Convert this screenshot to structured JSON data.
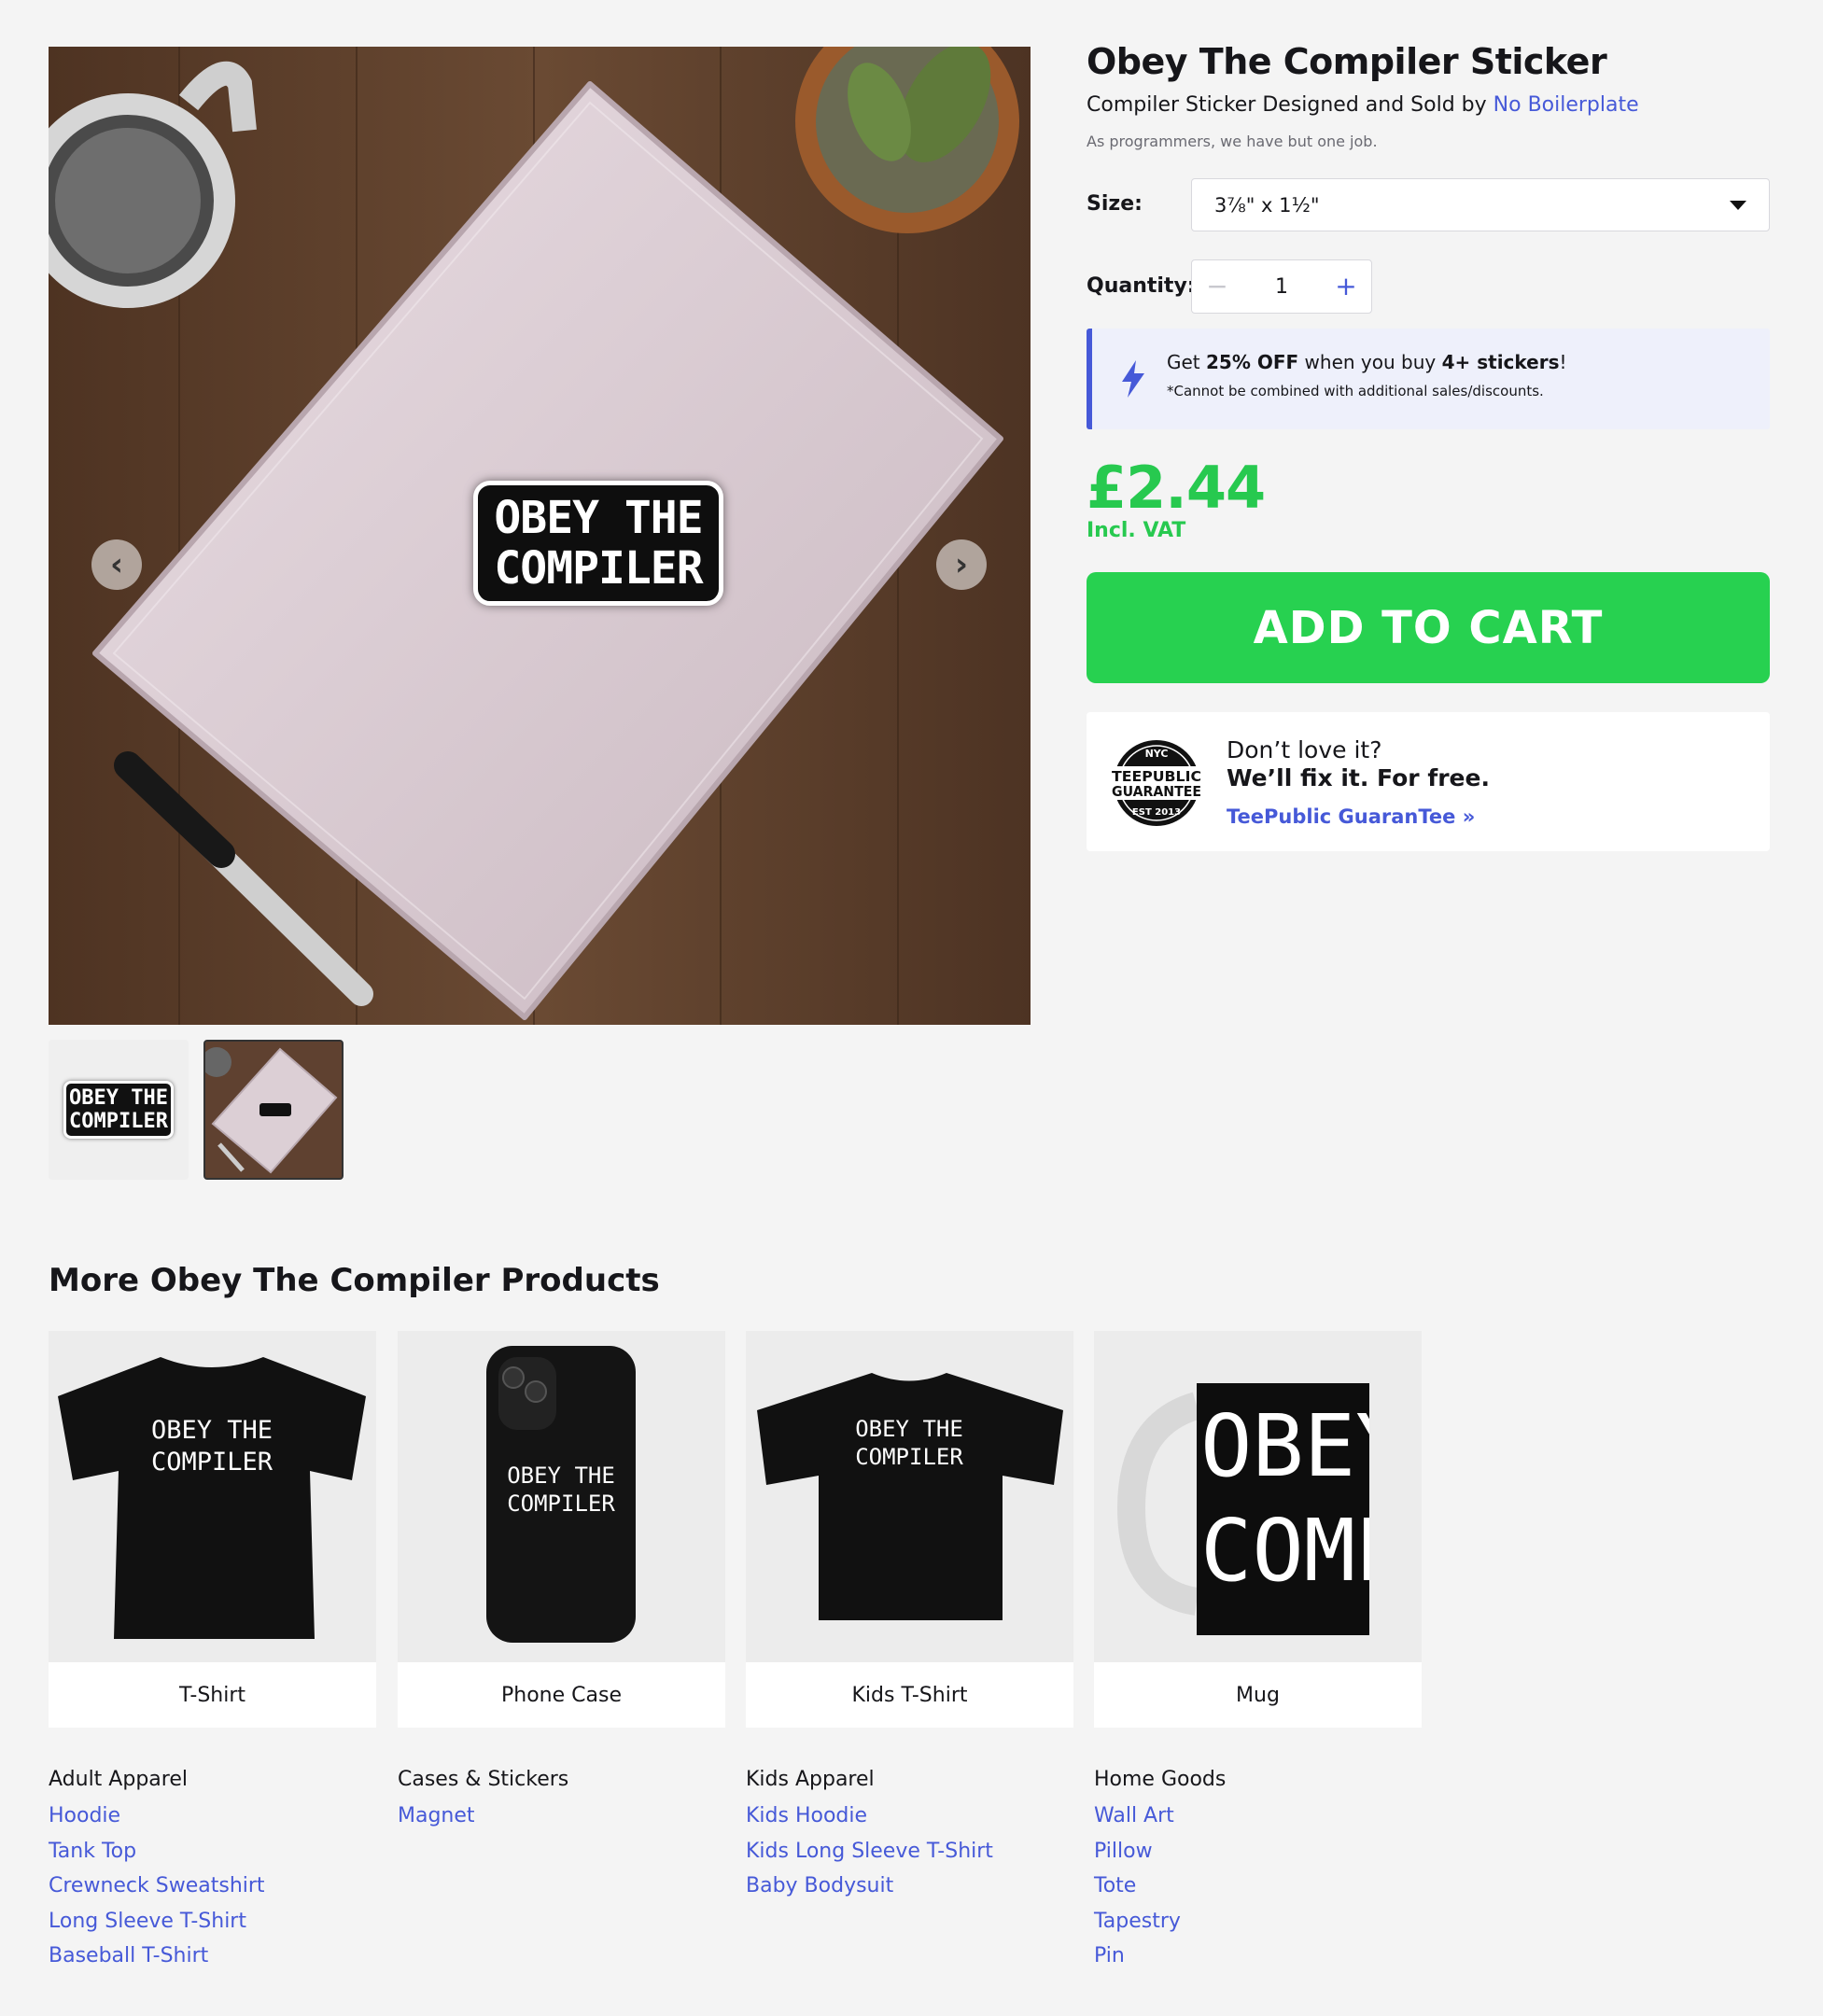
{
  "product": {
    "title": "Obey The Compiler Sticker",
    "subtitle_prefix": "Compiler Sticker Designed and Sold by",
    "seller": "No Boilerplate",
    "description": "As programmers, we have but one job.",
    "sticker_text": [
      "OBEY THE",
      "COMPILER"
    ]
  },
  "options": {
    "size_label": "Size:",
    "size_value": "3⅞\" x 1½\"",
    "quantity_label": "Quantity:",
    "quantity_value": "1",
    "minus": "−",
    "plus": "+"
  },
  "promo": {
    "get": "Get",
    "discount": "25% OFF",
    "middle": "when you buy",
    "count": "4+ stickers",
    "end": "!",
    "note": "*Cannot be combined with additional sales/discounts."
  },
  "pricing": {
    "price": "£2.44",
    "vat": "Incl. VAT",
    "cta": "ADD TO CART"
  },
  "guarantee": {
    "question": "Don’t love it?",
    "answer": "We’ll fix it. For free.",
    "link": "TeePublic GuaranTee »",
    "seal_top": "NYC",
    "seal_line1": "TEEPUBLIC",
    "seal_line2": "GUARANTEE",
    "seal_bottom": "EST 2013"
  },
  "gallery": {
    "prev": "‹",
    "next": "›"
  },
  "more": {
    "title": "More Obey The Compiler Products",
    "products": [
      {
        "label": "T-Shirt"
      },
      {
        "label": "Phone Case"
      },
      {
        "label": "Kids T-Shirt"
      },
      {
        "label": "Mug"
      }
    ],
    "mug_text": [
      "OBEY",
      "COMP"
    ],
    "categories": [
      {
        "head": "Adult Apparel",
        "links": [
          "Hoodie",
          "Tank Top",
          "Crewneck Sweatshirt",
          "Long Sleeve T-Shirt",
          "Baseball T-Shirt"
        ]
      },
      {
        "head": "Cases & Stickers",
        "links": [
          "Magnet"
        ]
      },
      {
        "head": "Kids Apparel",
        "links": [
          "Kids Hoodie",
          "Kids Long Sleeve T-Shirt",
          "Baby Bodysuit"
        ]
      },
      {
        "head": "Home Goods",
        "links": [
          "Wall Art",
          "Pillow",
          "Tote",
          "Tapestry",
          "Pin"
        ]
      }
    ]
  },
  "colors": {
    "accent_blue": "#4659d8",
    "price_green": "#27c94f",
    "cta_green": "#27d150",
    "page_bg": "#f4f4f4"
  }
}
